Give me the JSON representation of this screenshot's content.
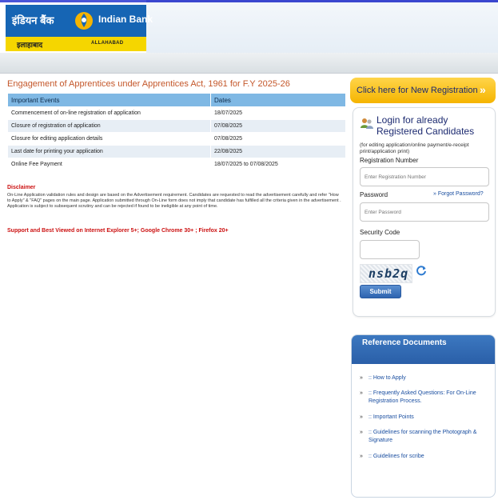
{
  "header": {
    "logo_hindi": "इंडियन बैंक",
    "logo_english": "Indian Bank",
    "logo_hindi_sub": "इलाहाबाद",
    "logo_sub": "ALLAHABAD",
    "logo_colors": {
      "blue": "#1665b4",
      "yellow": "#f5d600"
    }
  },
  "main": {
    "title": "Engagement of Apprentices under Apprentices Act, 1961 for F.Y 2025-26",
    "table": {
      "headers": [
        "Important Events",
        "Dates"
      ],
      "rows": [
        [
          "Commencement of on-line registration of application",
          "18/07/2025"
        ],
        [
          "Closure of registration of application",
          "07/08/2025"
        ],
        [
          "Closure for editing application details",
          "07/08/2025"
        ],
        [
          "Last date for printing your application",
          "22/08/2025"
        ],
        [
          "Online Fee Payment",
          "18/07/2025 to 07/08/2025"
        ]
      ]
    },
    "disclaimer_title": "Disclaimer",
    "disclaimer_text": "On-Line Application validation rules and design are based on the Advertisement requirement. Candidates are requested to read the advertisement carefully and refer \"How to Apply\" & \"FAQ\" pages on the main page. Application submitted through On-Line form does not imply that candidate has fulfilled all the criteria given in the advertisement . Application is subject to subsequent scrutiny and can be rejected if found to be ineligible at any point of time.",
    "support_text": "Support and Best Viewed on Internet Explorer 5+; Google Chrome 30+ ; Firefox 20+"
  },
  "new_registration": {
    "label": "Click here for New Registration",
    "arrow": "»"
  },
  "login": {
    "title": "Login for already Registered Candidates",
    "note": "(for editing application/online payment/e-receipt print/application print)",
    "regno_label": "Registration Number",
    "regno_placeholder": "Enter Registration Number",
    "password_label": "Password",
    "forgot_label": "»  Forgot Password?",
    "password_placeholder": "Enter Password",
    "security_label": "Security Code",
    "captcha": "nsb2q",
    "submit_label": "Submit"
  },
  "reference": {
    "title": "Reference Documents",
    "items": [
      ":: How to Apply",
      ":: Frequently Asked Questions: For On-Line Registration Process.",
      ":: Important Points",
      ":: Guidelines for scanning the Photograph & Signature",
      ":: Guidelines for scribe"
    ],
    "chevron": "»"
  }
}
